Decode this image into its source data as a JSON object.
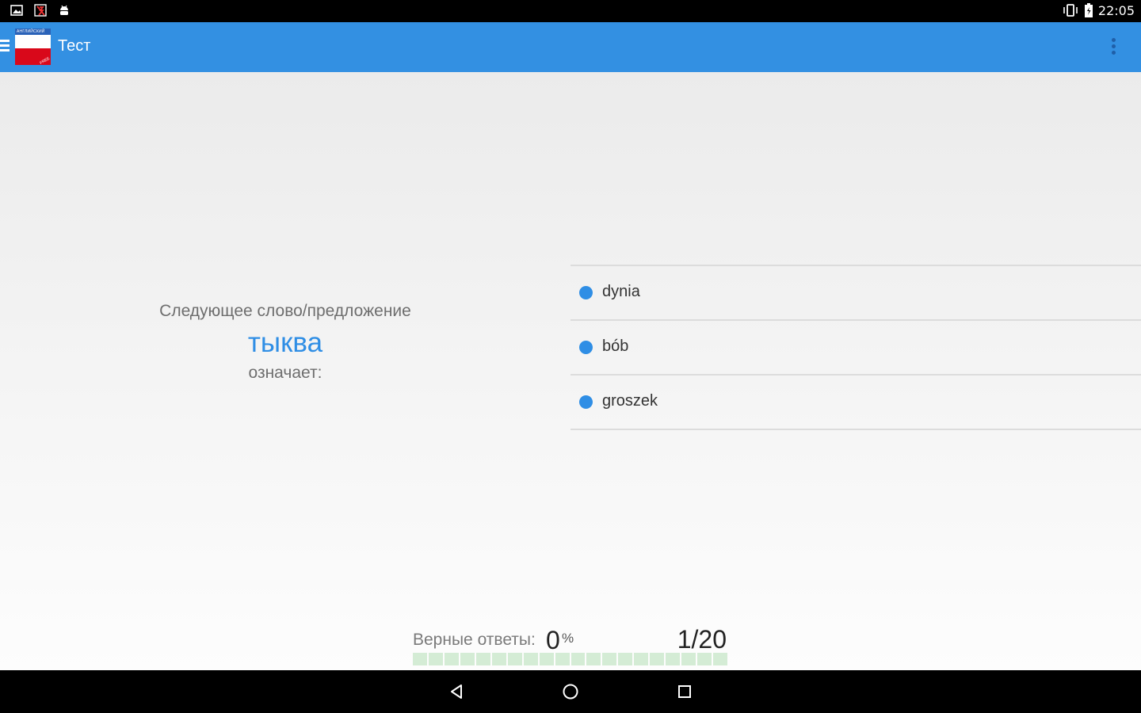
{
  "status_bar": {
    "time": "22:05",
    "icons": [
      "image-notification-icon",
      "no-flash-icon",
      "android-icon",
      "vibrate-icon",
      "battery-charging-icon"
    ]
  },
  "app_bar": {
    "title": "Тест",
    "logo_top_text": "АНГЛИЙСКИЙ",
    "logo_badge_text": "FREE",
    "color": "#3390e2"
  },
  "question": {
    "prompt": "Следующее слово/предложение",
    "word": "тыква",
    "means": "означает:"
  },
  "answers": [
    {
      "label": "dynia"
    },
    {
      "label": "bób"
    },
    {
      "label": "groszek"
    }
  ],
  "score": {
    "label": "Верные ответы:",
    "value": "0",
    "unit": "%",
    "progress_text": "1/20",
    "progress_segments": 20,
    "correct_fraction": 0
  },
  "colors": {
    "accent": "#2f8ee5",
    "progress_empty": "#d4ecd5"
  }
}
